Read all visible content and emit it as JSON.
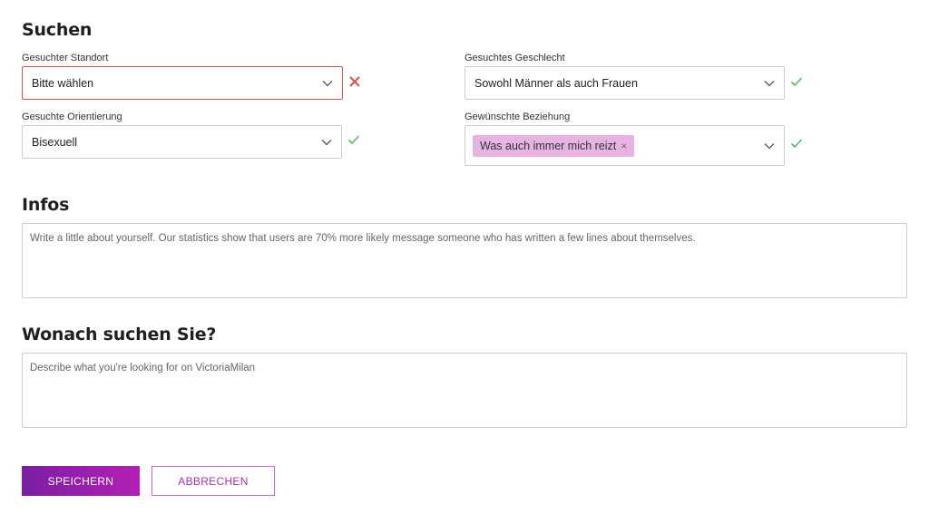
{
  "search": {
    "title": "Suchen",
    "location": {
      "label": "Gesuchter Standort",
      "value": "Bitte wählen",
      "status": "invalid"
    },
    "gender": {
      "label": "Gesuchtes Geschlecht",
      "value": "Sowohl Männer als auch Frauen",
      "status": "valid"
    },
    "orientation": {
      "label": "Gesuchte Orientierung",
      "value": "Bisexuell",
      "status": "valid"
    },
    "relationship": {
      "label": "Gewünschte Beziehung",
      "tags": [
        "Was auch immer mich reizt"
      ],
      "status": "valid"
    }
  },
  "infos": {
    "title": "Infos",
    "placeholder": "Write a little about yourself. Our statistics show that users are 70% more likely message someone who has written a few lines about themselves."
  },
  "looking_for": {
    "title": "Wonach suchen Sie?",
    "placeholder": "Describe what you're looking for on VictoriaMilan"
  },
  "actions": {
    "save_label": "SPEICHERN",
    "cancel_label": "ABBRECHEN"
  },
  "colors": {
    "accent": "#9b1fb0",
    "error": "#d9534f",
    "success": "#5cb85c",
    "tag_bg": "#e7b3e2"
  },
  "icons": {
    "select_arrow": "chevron-down-icon",
    "invalid": "x-mark-icon",
    "valid": "checkmark-icon",
    "tag_remove": "close-icon"
  }
}
